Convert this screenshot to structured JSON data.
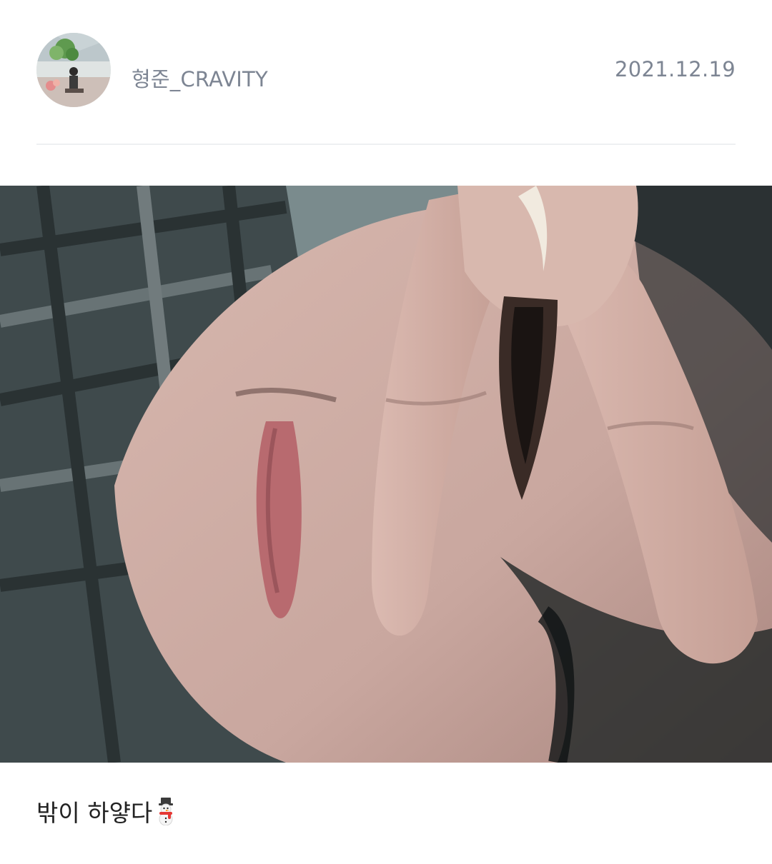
{
  "post": {
    "author": "형준_CRAVITY",
    "date": "2021.12.19",
    "caption": "밖이 하얗다"
  },
  "icons": {
    "avatar": "profile-photo",
    "emoji": "snowman-icon"
  },
  "colors": {
    "meta_text": "#7d8593",
    "divider": "#eef0f2",
    "caption_text": "#222222"
  }
}
